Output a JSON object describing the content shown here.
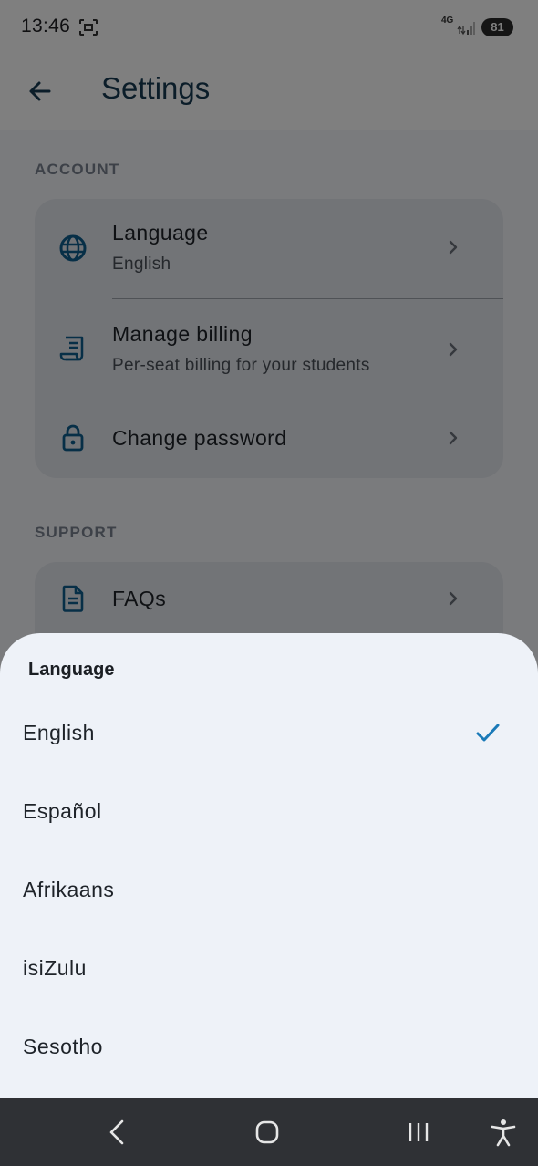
{
  "status_bar": {
    "time": "13:46",
    "network": "4G",
    "battery": "81"
  },
  "app_bar": {
    "title": "Settings",
    "back_icon": "arrow-left-icon"
  },
  "sections": [
    {
      "label": "ACCOUNT",
      "items": [
        {
          "title": "Language",
          "subtitle": "English",
          "icon": "globe-icon"
        },
        {
          "title": "Manage billing",
          "subtitle": "Per-seat billing for your students",
          "icon": "receipt-icon"
        },
        {
          "title": "Change password",
          "icon": "lock-icon"
        }
      ]
    },
    {
      "label": "SUPPORT",
      "items": [
        {
          "title": "FAQs",
          "icon": "document-icon"
        }
      ]
    }
  ],
  "language_sheet": {
    "title": "Language",
    "selected": "English",
    "options": [
      "English",
      "Español",
      "Afrikaans",
      "isiZulu",
      "Sesotho"
    ]
  },
  "nav_bar": {
    "buttons": [
      "back-icon",
      "home-icon",
      "recents-icon",
      "accessibility-icon"
    ]
  },
  "colors": {
    "accent": "#1a7ab8",
    "icon": "#0f5f8f",
    "title": "#163a52",
    "sheet_bg": "#eef2f8",
    "card_bg": "#e5e8ee",
    "nav_bg": "#2f3135"
  }
}
